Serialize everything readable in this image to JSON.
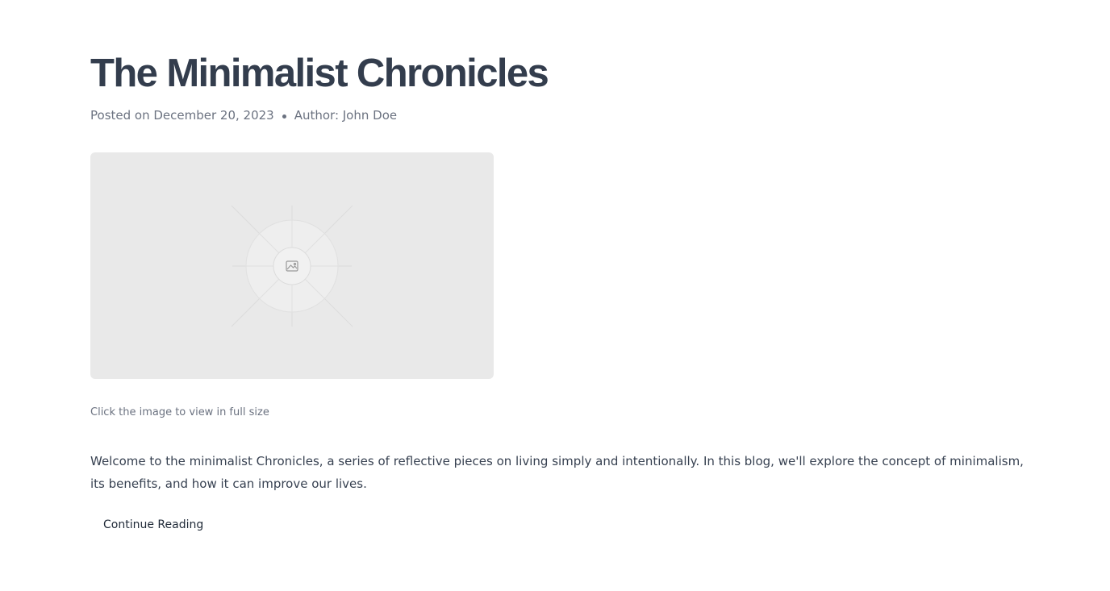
{
  "post": {
    "title": "The Minimalist Chronicles",
    "date_text": "Posted on December 20, 2023",
    "author_text": "Author: John Doe",
    "image_icon": "image-icon",
    "image_caption": "Click the image to view in full size",
    "excerpt": "Welcome to the minimalist Chronicles, a series of reflective pieces on living simply and intentionally. In this blog, we'll explore the concept of minimalism, its benefits, and how it can improve our lives.",
    "continue_label": "Continue Reading"
  },
  "colors": {
    "title": "#333d4d",
    "meta": "#6b7280",
    "body_text": "#374151",
    "image_placeholder_bg": "#e9e9e9"
  }
}
